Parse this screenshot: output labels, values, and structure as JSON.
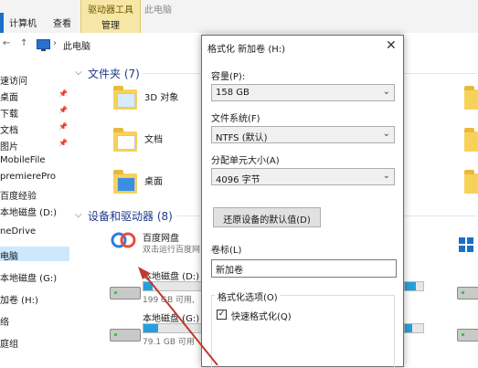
{
  "ribbon": {
    "tabs": [
      "计算机",
      "查看"
    ],
    "context_group_title": "驱动器工具",
    "context_tab": "管理",
    "window_title": "此电脑"
  },
  "address_bar": {
    "back_glyph": "←",
    "up_glyph": "↑",
    "path": "此电脑"
  },
  "nav_pane": {
    "items": [
      {
        "label": "速访问",
        "pinned": false
      },
      {
        "label": "桌面",
        "pinned": true
      },
      {
        "label": "下载",
        "pinned": true
      },
      {
        "label": "文档",
        "pinned": true
      },
      {
        "label": "图片",
        "pinned": true
      },
      {
        "label": "MobileFile",
        "pinned": false
      },
      {
        "label": "premierePro",
        "pinned": false
      },
      {
        "label": "百度经验",
        "pinned": false
      },
      {
        "label": "本地磁盘 (D:)",
        "pinned": false
      },
      {
        "label": "neDrive",
        "pinned": false
      },
      {
        "label": "电脑",
        "pinned": false,
        "selected": true
      },
      {
        "label": "本地磁盘 (G:)",
        "pinned": false
      },
      {
        "label": "加卷 (H:)",
        "pinned": false
      },
      {
        "label": "络",
        "pinned": false
      },
      {
        "label": "庭组",
        "pinned": false
      }
    ]
  },
  "content": {
    "folders_group": "文件夹 (7)",
    "folders": [
      {
        "name": "3D 对象"
      },
      {
        "name": "文档"
      },
      {
        "name": "桌面"
      }
    ],
    "devices_group": "设备和驱动器 (8)",
    "baidu": {
      "name": "百度网盘",
      "subtitle": "双击运行百度网"
    },
    "drives": [
      {
        "name": "本地磁盘 (D:)",
        "free": "199 GB 可用,",
        "used_fraction": 0.15
      },
      {
        "name": "本地磁盘 (G:)",
        "free": "79.1 GB 可用",
        "used_fraction": 0.25
      }
    ]
  },
  "dialog": {
    "title": "格式化 新加卷 (H:)",
    "close_glyph": "✕",
    "capacity_label": "容量(P):",
    "capacity_value": "158 GB",
    "fs_label": "文件系统(F)",
    "fs_value": "NTFS (默认)",
    "alloc_label": "分配单元大小(A)",
    "alloc_value": "4096 字节",
    "restore_button": "还原设备的默认值(D)",
    "volume_label": "卷标(L)",
    "volume_value": "新加卷",
    "options_label": "格式化选项(O)",
    "quick_format_label": "快速格式化(Q)",
    "quick_format_checked": true,
    "check_glyph": "✓"
  },
  "colors": {
    "accent": "#1a6fc9",
    "context_tab": "#f7e7a6",
    "selected_nav": "#cce8ff",
    "progress": "#26a0da",
    "arrow": "#c0392b"
  }
}
